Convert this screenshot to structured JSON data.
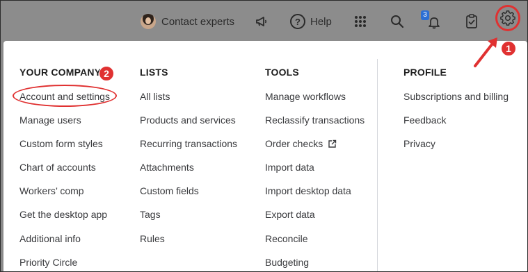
{
  "topbar": {
    "contact_label": "Contact experts",
    "help_label": "Help",
    "notifications_count": "3"
  },
  "menu": {
    "your_company": {
      "heading": "YOUR COMPANY",
      "items": [
        "Account and settings",
        "Manage users",
        "Custom form styles",
        "Chart of accounts",
        "Workers’ comp",
        "Get the desktop app",
        "Additional info",
        "Priority Circle"
      ]
    },
    "lists": {
      "heading": "LISTS",
      "items": [
        "All lists",
        "Products and services",
        "Recurring transactions",
        "Attachments",
        "Custom fields",
        "Tags",
        "Rules"
      ]
    },
    "tools": {
      "heading": "TOOLS",
      "items": [
        "Manage workflows",
        "Reclassify transactions",
        "Order checks",
        "Import data",
        "Import desktop data",
        "Export data",
        "Reconcile",
        "Budgeting"
      ]
    },
    "profile": {
      "heading": "PROFILE",
      "items": [
        "Subscriptions and billing",
        "Feedback",
        "Privacy"
      ]
    }
  },
  "annotations": {
    "step1": "1",
    "step2": "2",
    "color": "#e03131"
  },
  "icons": [
    "megaphone-icon",
    "help-icon",
    "apps-grid-icon",
    "search-icon",
    "bell-icon",
    "clipboard-check-icon",
    "gear-icon",
    "external-link-icon"
  ]
}
